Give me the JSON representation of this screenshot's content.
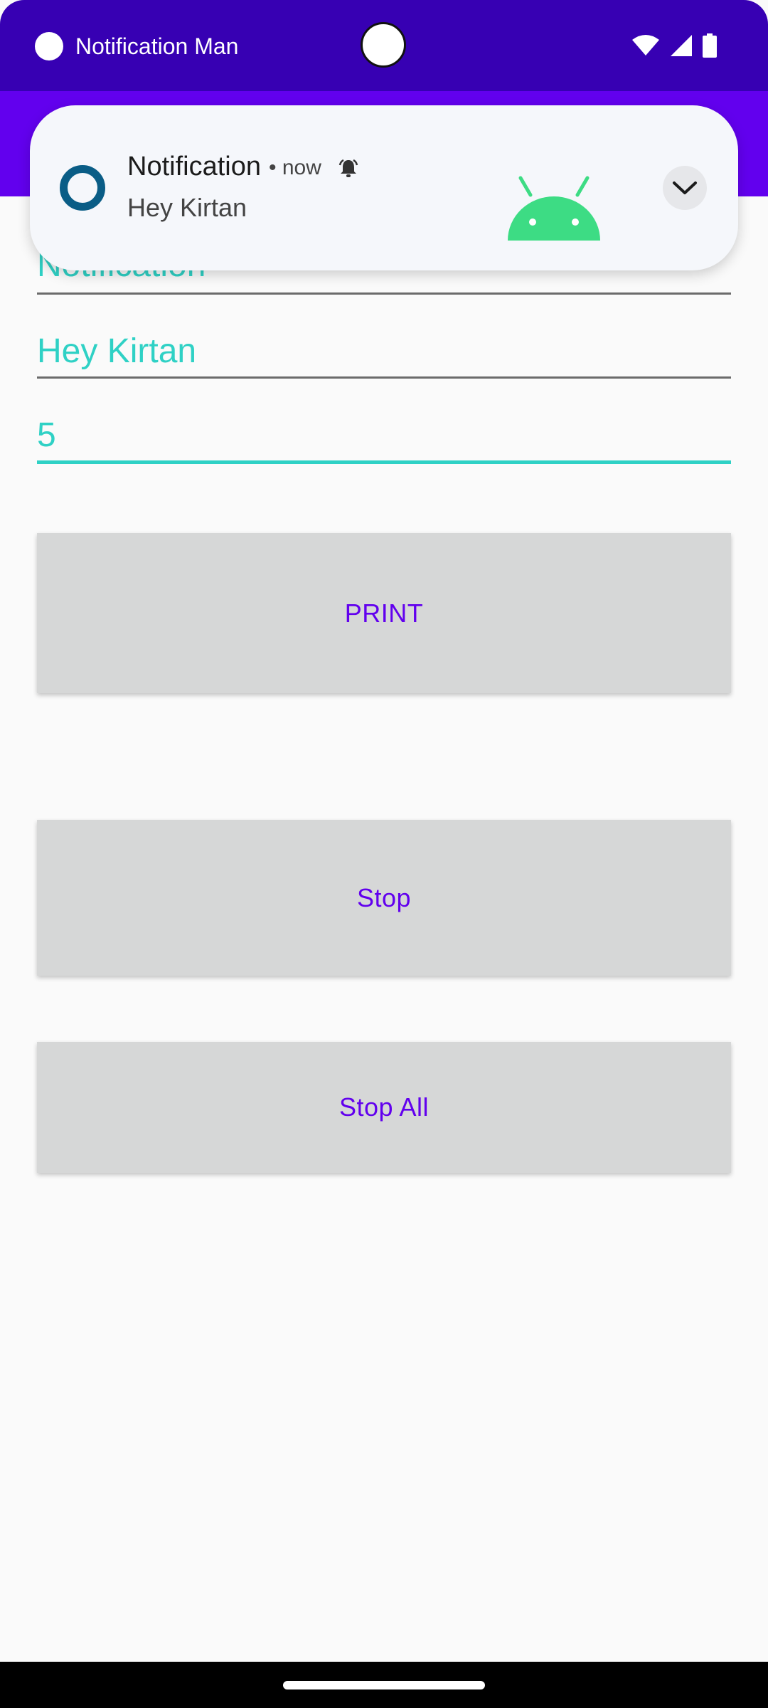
{
  "status_bar": {
    "title": "Notification Man",
    "icons": [
      "wifi-icon",
      "cellular-signal-icon",
      "battery-icon"
    ]
  },
  "form": {
    "title_field": {
      "value": "Notification"
    },
    "message_field": {
      "value": "Hey Kirtan"
    },
    "count_field": {
      "value": "5"
    }
  },
  "buttons": {
    "print_label": "PRINT",
    "stop_label": "Stop",
    "stop_all_label": "Stop All"
  },
  "notification": {
    "title": "Notification",
    "meta": "• now",
    "text": "Hey Kirtan",
    "icons": [
      "app-ring-icon",
      "alert-bell-icon",
      "android-robot-icon",
      "chevron-down-icon"
    ]
  },
  "colors": {
    "status_bar": "#3700b3",
    "app_bar": "#6200ee",
    "accent_text": "#2fd1c5",
    "button_text": "#6200ee",
    "button_bg": "#d6d7d7",
    "android_green": "#3ddc84",
    "notification_icon": "#0a5d86"
  }
}
